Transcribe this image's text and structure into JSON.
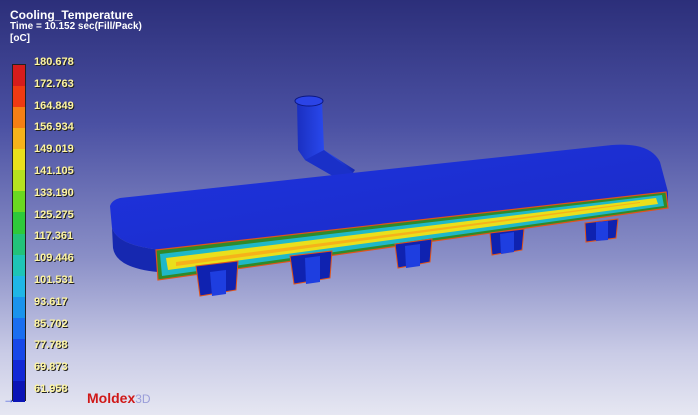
{
  "result_title": "Cooling_Temperature",
  "time_label": "Time = 10.152 sec(Fill/Pack)",
  "unit_label": "[oC]",
  "legend": {
    "values": [
      "180.678",
      "172.763",
      "164.849",
      "156.934",
      "149.019",
      "141.105",
      "133.190",
      "125.275",
      "117.361",
      "109.446",
      "101.531",
      "93.617",
      "85.702",
      "77.788",
      "69.873",
      "61.958"
    ],
    "colors": [
      "#d61c1c",
      "#ef3a12",
      "#f57f14",
      "#f6b21a",
      "#eadf1c",
      "#b6e21f",
      "#6ad821",
      "#2ec93a",
      "#22c27a",
      "#1ec4b6",
      "#1fb6e6",
      "#1a93ec",
      "#1a6ef0",
      "#1748e8",
      "#1228d6",
      "#0b14b6"
    ]
  },
  "brand": {
    "name": "Moldex",
    "suffix": "3D"
  },
  "icons": {
    "min_marker": "arrow-right-icon"
  }
}
